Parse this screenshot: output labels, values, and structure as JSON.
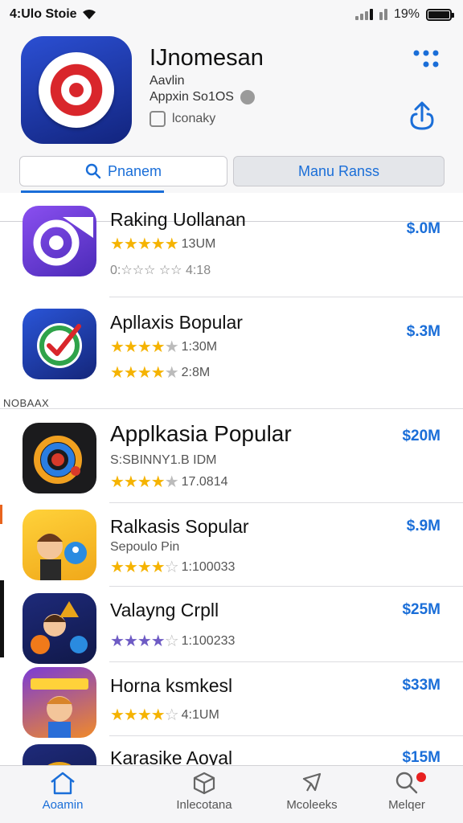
{
  "status_bar": {
    "left_text": "4:Ulo Stoie",
    "battery": "19%"
  },
  "app": {
    "title": "IJnomesan",
    "line1": "Aavlin",
    "line2": "Appxin So1OS",
    "line3": "lconaky"
  },
  "tabs": {
    "left": "Pnanem",
    "right": "Manu Ranss"
  },
  "section_label": "NOBAAX",
  "rows": [
    {
      "title": "Raking Uollanan",
      "rating_text": "13UM",
      "line2": "0:☆☆☆ ☆☆ 4:18",
      "price": "$.0M"
    },
    {
      "title": "Apllaxis Bopular",
      "rating_text": "1:30M",
      "rating2_text": "2:8M",
      "price": "$.3M"
    },
    {
      "title": "Applkasia Popular",
      "line2": "S:SBINNY1.B IDM",
      "rating_text": "17.0814",
      "price": "$20M"
    },
    {
      "title": "Ralkasis Sopular",
      "line2": "Sepoulo Pin",
      "rating_text": "1:100033",
      "price": "$.9M"
    },
    {
      "title": "Valayng Crpll",
      "rating_text": "1:100233",
      "price": "$25M"
    },
    {
      "title": "Horna ksmkesl",
      "rating_text": "4:1UM",
      "price": "$33M"
    },
    {
      "title": "Karasike Aoyal",
      "price": "$15M"
    }
  ],
  "tab_bar": [
    "Aoamin",
    "Inlecotana",
    "Mcoleeks",
    "Melqer"
  ]
}
